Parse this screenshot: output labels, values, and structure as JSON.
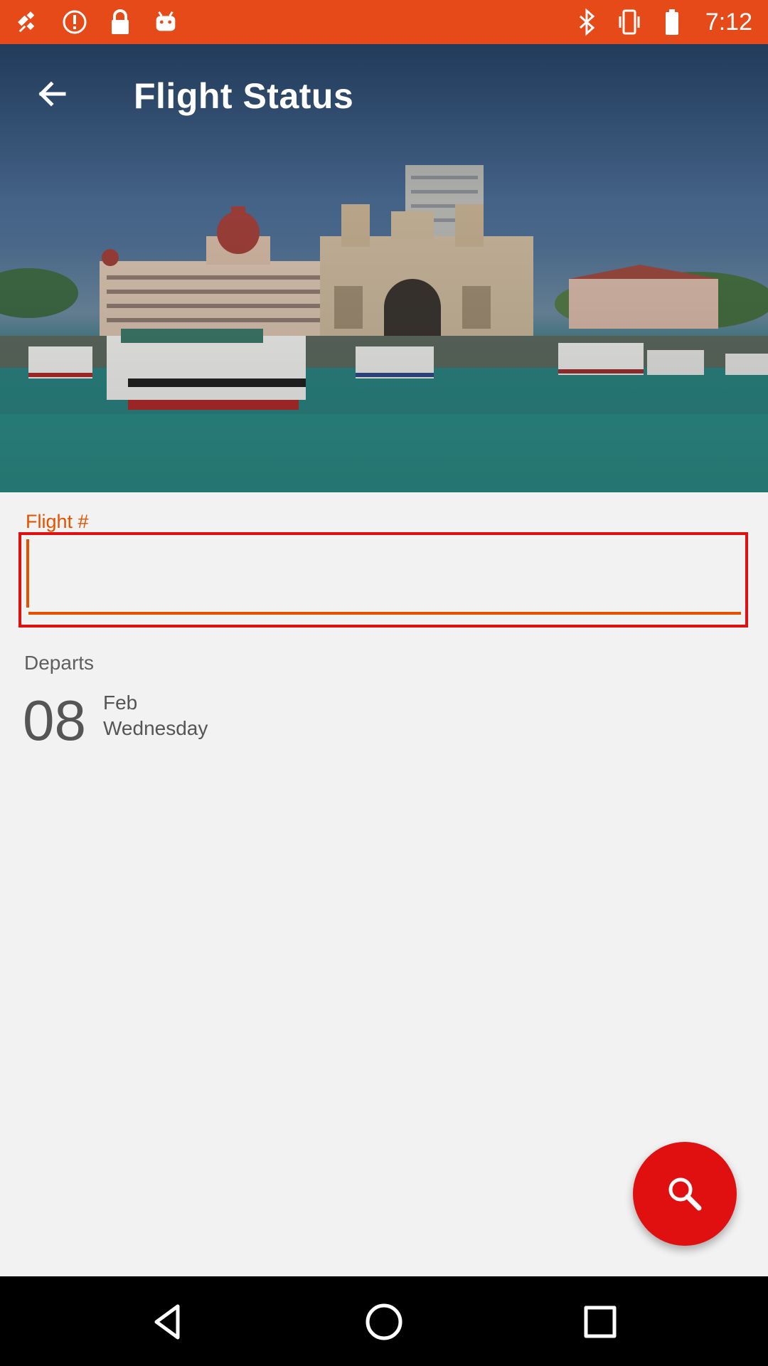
{
  "status_bar": {
    "time": "7:12",
    "background_color": "#e64a19",
    "left_icons": [
      "fake-gps-icon",
      "alert-icon",
      "lock-icon",
      "android-icon"
    ],
    "right_icons": [
      "bluetooth-icon",
      "vibrate-icon",
      "battery-icon"
    ]
  },
  "app_bar": {
    "title": "Flight Status",
    "back_icon": "arrow-left-icon"
  },
  "form": {
    "flight_label": "Flight #",
    "flight_value": "",
    "departs_label": "Departs",
    "date": {
      "day": "08",
      "month": "Feb",
      "weekday": "Wednesday"
    }
  },
  "fab": {
    "icon": "search-icon",
    "color": "#e01010"
  },
  "nav_bar": {
    "buttons": [
      "back-triangle-icon",
      "home-circle-icon",
      "recents-square-icon"
    ]
  },
  "colors": {
    "accent": "#e65100",
    "highlight_border": "#e01010",
    "background": "#f2f2f2"
  }
}
